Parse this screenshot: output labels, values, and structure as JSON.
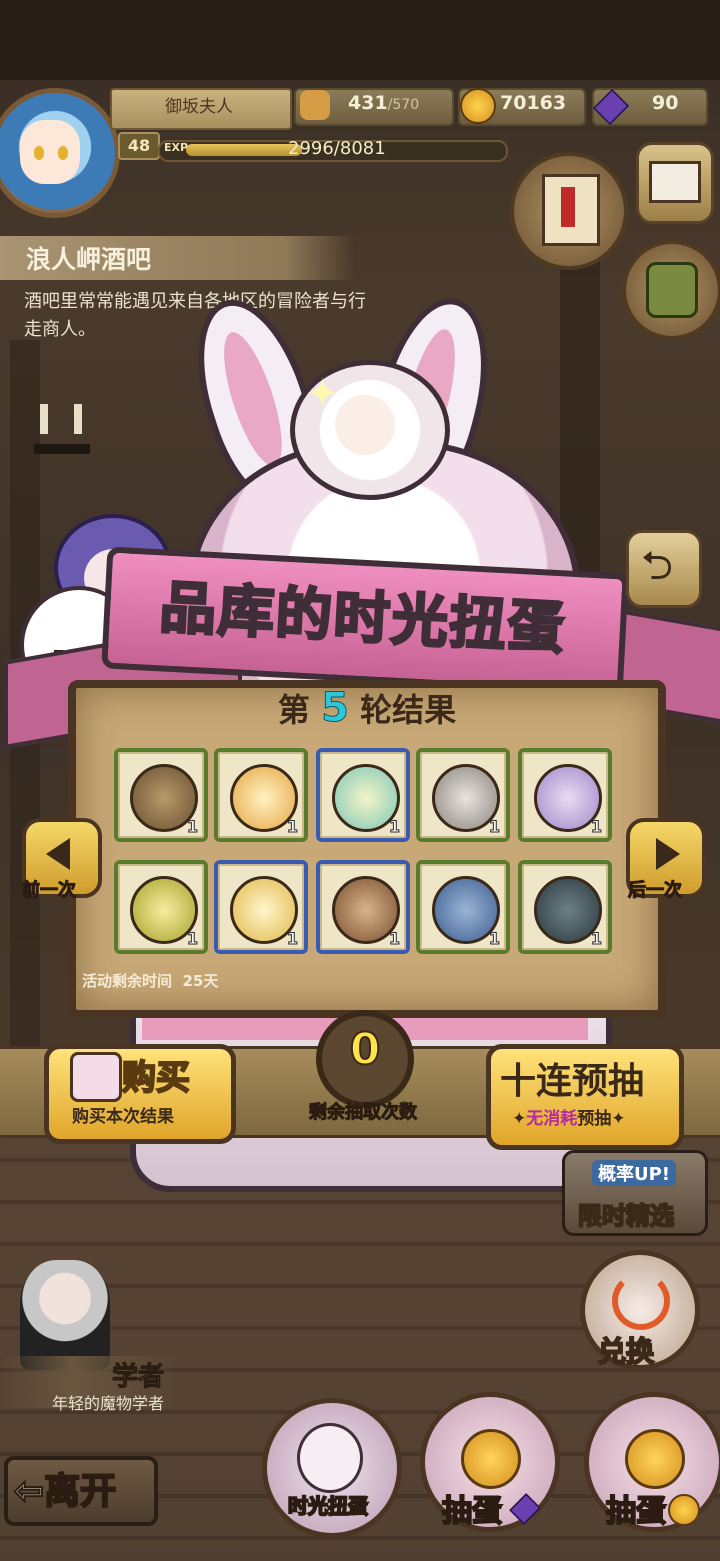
{
  "player": {
    "name": "御坂夫人",
    "level": "48",
    "exp_tag": "EXP",
    "exp": "2996/8081",
    "exp_fraction": 0.37
  },
  "resources": {
    "stamina_value": "431",
    "stamina_max": "/570",
    "gold": "70163",
    "gems": "90"
  },
  "location": {
    "title": "浪人岬酒吧",
    "desc": "酒吧里常常能遇见来自各地区的冒险者与行走商人。"
  },
  "banner": {
    "title_part1": "品库的",
    "title_highlight": "时光",
    "title_part2": "扭蛋"
  },
  "results": {
    "prefix": "第",
    "round": "5",
    "suffix": "轮结果",
    "items": [
      {
        "icon": "wooden-egg-icon",
        "count": "1",
        "rarity": "green"
      },
      {
        "icon": "bandaged-egg-icon",
        "count": "1",
        "rarity": "green"
      },
      {
        "icon": "easter-egg-icon",
        "count": "1",
        "rarity": "blue"
      },
      {
        "icon": "cat-ears-helmet-icon",
        "count": "1",
        "rarity": "green"
      },
      {
        "icon": "purple-pouch-icon",
        "count": "1",
        "rarity": "green"
      },
      {
        "icon": "hatched-egg-nest-icon",
        "count": "1",
        "rarity": "green"
      },
      {
        "icon": "angel-wing-helmet-icon",
        "count": "1",
        "rarity": "blue"
      },
      {
        "icon": "bear-hat-icon",
        "count": "1",
        "rarity": "blue"
      },
      {
        "icon": "shell-icon",
        "count": "1",
        "rarity": "green"
      },
      {
        "icon": "turtle-shell-icon",
        "count": "1",
        "rarity": "green"
      }
    ],
    "timer_label": "活动剩余时间",
    "timer_value": "25天"
  },
  "nav": {
    "prev": "前一次",
    "next": "后一次"
  },
  "actions": {
    "buy": "购买",
    "buy_sub": "购买本次结果",
    "remaining_count": "0",
    "remaining_label": "剩余抽取次数",
    "ten_draw": "十连预抽",
    "ten_sub_hl": "无消耗",
    "ten_sub": "预抽"
  },
  "side": {
    "rate_up": "概率UP!",
    "limited": "限时精选",
    "exchange": "兑换"
  },
  "npc": {
    "name": "学者",
    "sub": "年轻的魔物学者"
  },
  "bottom": {
    "leave": "离开",
    "tab1": "时光扭蛋",
    "tab2": "抽蛋",
    "tab3": "抽蛋"
  },
  "colors": {
    "rarity_green": "#5a7a2c",
    "rarity_blue": "#3a5bb0",
    "round_number": "#2cc7d9",
    "counter": "#ffe34a"
  }
}
